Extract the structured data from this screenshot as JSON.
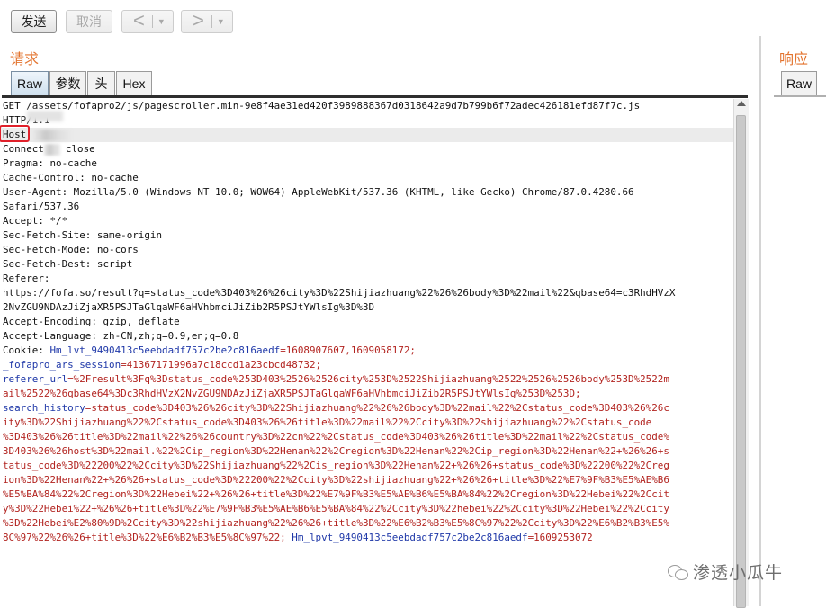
{
  "toolbar": {
    "send_label": "发送",
    "cancel_label": "取消",
    "back_label": "<",
    "forward_label": ">",
    "dropdown_glyph": "▼"
  },
  "request": {
    "title": "请求",
    "tabs": [
      "Raw",
      "参数",
      "头",
      "Hex"
    ],
    "active_tab": "Raw",
    "lines": {
      "l01": "GET /assets/fofapro2/js/pagescroller.min-9e8f4ae31ed420f3989888367d0318642a9d7b799b6f72adec426181efd87f7c.js",
      "l02": "HTTP/1.1",
      "l03": "Host",
      "l04_key": "Connect",
      "l04_val": "close",
      "l05": "Pragma: no-cache",
      "l06": "Cache-Control: no-cache",
      "l07": "User-Agent: Mozilla/5.0 (Windows NT 10.0; WOW64) AppleWebKit/537.36 (KHTML, like Gecko) Chrome/87.0.4280.66",
      "l08": "Safari/537.36",
      "l09": "Accept: */*",
      "l10": "Sec-Fetch-Site: same-origin",
      "l11": "Sec-Fetch-Mode: no-cors",
      "l12": "Sec-Fetch-Dest: script",
      "l13": "Referer:",
      "l14": "https://fofa.so/result?q=status_code%3D403%26%26city%3D%22Shijiazhuang%22%26%26body%3D%22mail%22&qbase64=c3RhdHVzX",
      "l15": "2NvZGU9NDAzJiZjaXR5PSJTaGlqaWF6aHVhbmciJiZib2R5PSJtYWlsIg%3D%3D",
      "l16": "Accept-Encoding: gzip, deflate",
      "l17": "Accept-Language: zh-CN,zh;q=0.9,en;q=0.8",
      "l18_prefix": "Cookie: ",
      "l18_key": "Hm_lvt_9490413c5eebdadf757c2be2c816aedf",
      "l18_val": "=1608907607,1609058172;",
      "l19_key": "_fofapro_ars_session",
      "l19_val": "=41367171996a7c18ccd1a23cbcd48732;",
      "l20_key": "referer_url",
      "l20_val": "=%2Fresult%3Fq%3Dstatus_code%253D403%2526%2526city%253D%2522Shijiazhuang%2522%2526%2526body%253D%2522m",
      "l21": "ail%2522%26qbase64%3Dc3RhdHVzX2NvZGU9NDAzJiZjaXR5PSJTaGlqaWF6aHVhbmciJiZib2R5PSJtYWlsIg%253D%253D;",
      "l22_key": "search_history",
      "l22_val": "=status_code%3D403%26%26city%3D%22Shijiazhuang%22%26%26body%3D%22mail%22%2Cstatus_code%3D403%26%26c",
      "l23": "ity%3D%22Shijiazhuang%22%2Cstatus_code%3D403%26%26title%3D%22mail%22%2Ccity%3D%22shijiazhuang%22%2Cstatus_code",
      "l24": "%3D403%26%26title%3D%22mail%22%26%26country%3D%22cn%22%2Cstatus_code%3D403%26%26title%3D%22mail%22%2Cstatus_code%",
      "l25": "3D403%26%26host%3D%22mail.%22%2Cip_region%3D%22Henan%22%2Cregion%3D%22Henan%22%2Cip_region%3D%22Henan%22+%26%26+s",
      "l26": "tatus_code%3D%22200%22%2Ccity%3D%22Shijiazhuang%22%2Cis_region%3D%22Henan%22+%26%26+status_code%3D%22200%22%2Creg",
      "l27": "ion%3D%22Henan%22+%26%26+status_code%3D%22200%22%2Ccity%3D%22shijiazhuang%22+%26%26+title%3D%22%E7%9F%B3%E5%AE%B6",
      "l28": "%E5%BA%84%22%2Cregion%3D%22Hebei%22+%26%26+title%3D%22%E7%9F%B3%E5%AE%B6%E5%BA%84%22%2Cregion%3D%22Hebei%22%2Ccit",
      "l29": "y%3D%22Hebei%22+%26%26+title%3D%22%E7%9F%B3%E5%AE%B6%E5%BA%84%22%2Ccity%3D%22hebei%22%2Ccity%3D%22Hebei%22%2Ccity",
      "l30": "%3D%22Hebei%E2%80%9D%2Ccity%3D%22shijiazhuang%22%26%26+title%3D%22%E6%B2%B3%E5%8C%97%22%2Ccity%3D%22%E6%B2%B3%E5%",
      "l31_val": "8C%97%22%26%26+title%3D%22%E6%B2%B3%E5%8C%97%22; ",
      "l31_key": "Hm_lpvt_9490413c5eebdadf757c2be2c816aedf",
      "l31_val2": "=1609253072"
    }
  },
  "response": {
    "title": "响应",
    "tabs": [
      "Raw"
    ]
  },
  "watermark": {
    "text": "渗透小瓜牛"
  },
  "colors": {
    "section_title": "#e3742f",
    "cookie_key": "#1f38a8",
    "cookie_value": "#b2231f",
    "host_highlight_box": "#e0202a"
  }
}
